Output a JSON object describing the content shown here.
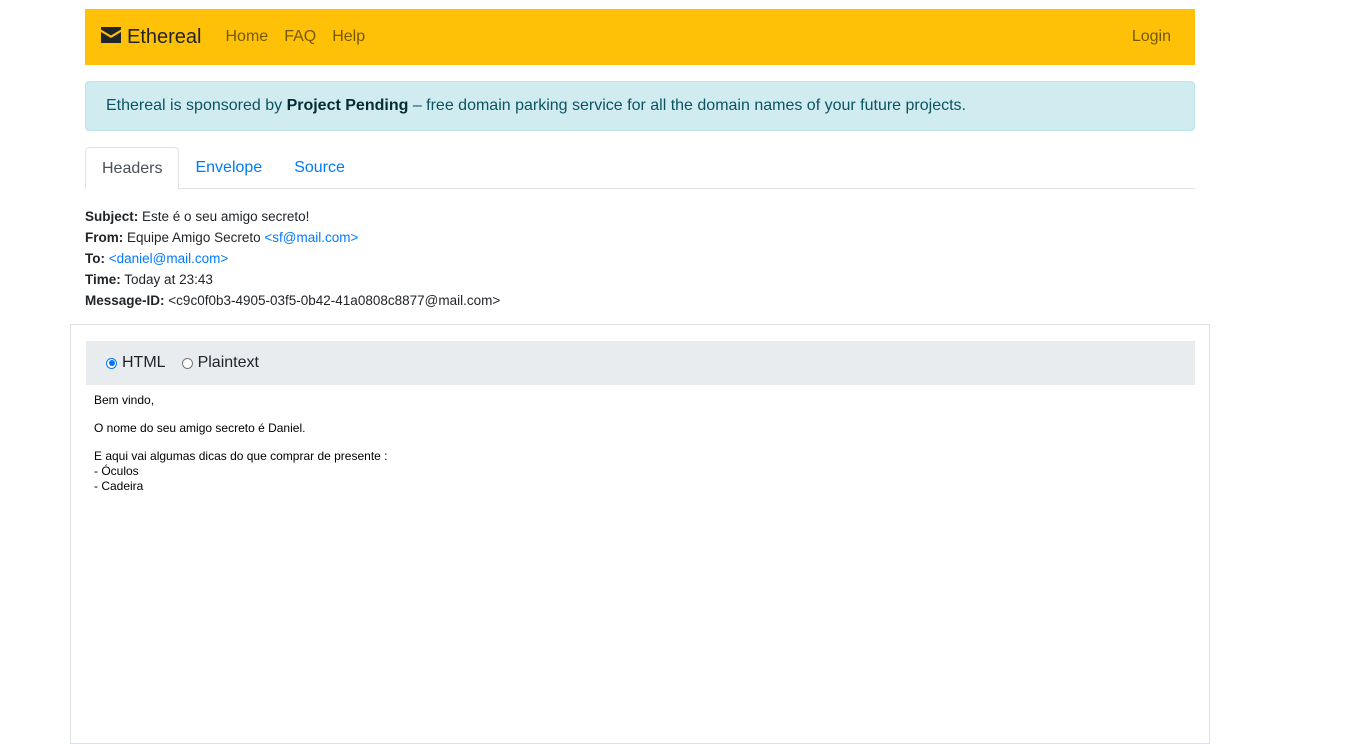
{
  "navbar": {
    "brand": "Ethereal",
    "links": [
      "Home",
      "FAQ",
      "Help"
    ],
    "login": "Login",
    "background": "#ffc107"
  },
  "alert": {
    "prefix": "Ethereal is sponsored by",
    "sponsor": "Project Pending",
    "suffix": "– free domain parking service for all the domain names of your future projects."
  },
  "tabs": [
    {
      "label": "Headers",
      "active": true
    },
    {
      "label": "Envelope",
      "active": false
    },
    {
      "label": "Source",
      "active": false
    }
  ],
  "headers": {
    "subject_label": "Subject:",
    "subject": "Este é o seu amigo secreto!",
    "from_label": "From:",
    "from_name": "Equipe Amigo Secreto",
    "from_addr": "<sf@mail.com>",
    "to_label": "To:",
    "to_addr": "<daniel@mail.com>",
    "time_label": "Time:",
    "time": "Today at 23:43",
    "message_id_label": "Message-ID:",
    "message_id": "<c9c0f0b3-4905-03f5-0b42-41a0808c8877@mail.com>"
  },
  "view_toggle": {
    "html_label": "HTML",
    "plaintext_label": "Plaintext",
    "selected": "HTML"
  },
  "message_body": {
    "greeting": "Bem vindo,",
    "line1": "O nome do seu amigo secreto é Daniel.",
    "line2": "E aqui vai algumas dicas do que comprar de presente :",
    "item1": "- Óculos",
    "item2": "- Cadeira"
  }
}
